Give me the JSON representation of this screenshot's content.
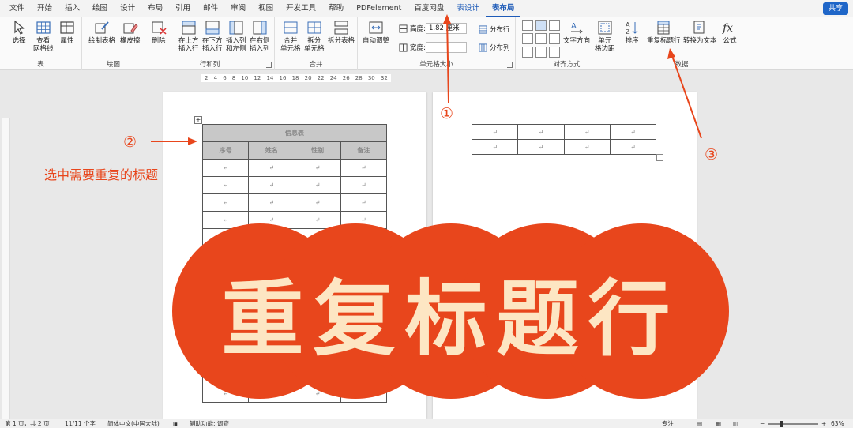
{
  "menu": {
    "items": [
      "文件",
      "开始",
      "插入",
      "绘图",
      "设计",
      "布局",
      "引用",
      "邮件",
      "审阅",
      "视图",
      "开发工具",
      "帮助",
      "PDFelement",
      "百度网盘",
      "表设计",
      "表布局"
    ],
    "share": "共享"
  },
  "ribbon": {
    "table_group": {
      "label": "表",
      "select": "选择",
      "gridlines": "查看\n网格线",
      "properties": "属性"
    },
    "draw_group": {
      "label": "绘图",
      "draw_table": "绘制表格",
      "eraser": "橡皮擦"
    },
    "rowcol_group": {
      "label": "行和列",
      "delete": "删除",
      "insert_above": "在上方\n插入行",
      "insert_below": "在下方\n插入行",
      "insert_left": "插入列\n和左侧",
      "insert_right": "在右侧\n插入列"
    },
    "merge_group": {
      "label": "合并",
      "merge_cells": "合并\n单元格",
      "split_cells": "拆分\n单元格",
      "split_table": "拆分表格"
    },
    "cellsize_group": {
      "label": "单元格大小",
      "autofit": "自动调整",
      "height_label": "高度:",
      "height_value": "1.82 厘米",
      "width_label": "宽度:",
      "width_value": "",
      "distribute_rows": "分布行",
      "distribute_cols": "分布列"
    },
    "align_group": {
      "label": "对齐方式",
      "text_direction": "文字方向",
      "cell_margins": "单元\n格边距"
    },
    "data_group": {
      "label": "数据",
      "sort": "排序",
      "repeat_header": "重复标题行",
      "convert_text": "转换为文本",
      "formula": "公式"
    }
  },
  "ruler": [
    "2",
    "4",
    "6",
    "8",
    "10",
    "12",
    "14",
    "16",
    "18",
    "20",
    "22",
    "24",
    "26",
    "28",
    "30",
    "32"
  ],
  "document": {
    "table_title": "信息表",
    "headers": [
      "序号",
      "姓名",
      "性别",
      "备注"
    ],
    "cell_mark": "↵"
  },
  "annotations": {
    "marker1": "①",
    "marker2": "②",
    "marker3": "③",
    "select_note": "选中需要重复的标题"
  },
  "banner": {
    "text": "重复标题行",
    "bg_color": "#e8461c",
    "text_color": "#fde6c3"
  },
  "statusbar": {
    "page": "第 1 页，共 2 页",
    "words": "11/11 个字",
    "language": "简体中文(中国大陆)",
    "accessibility": "辅助功能: 调查",
    "focus": "专注",
    "zoom": "63%"
  }
}
